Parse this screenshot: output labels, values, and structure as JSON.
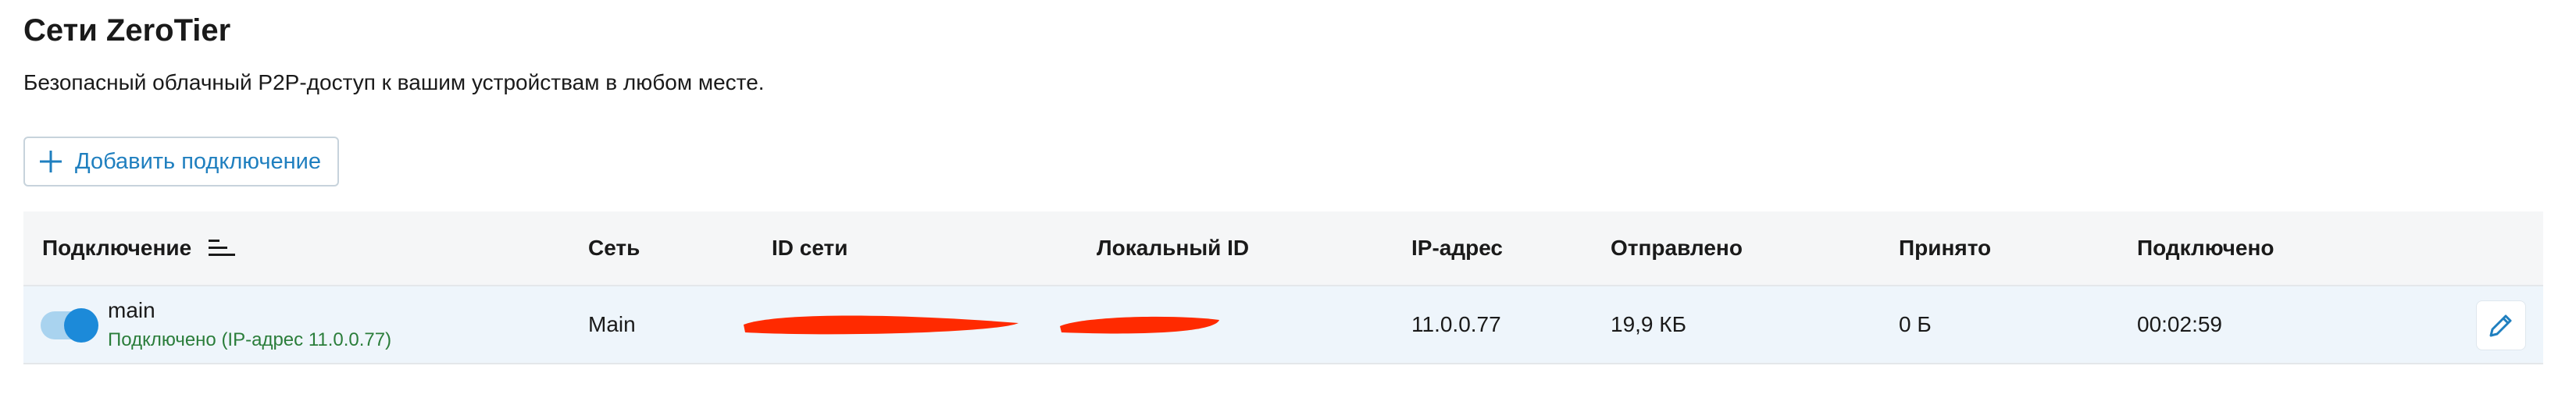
{
  "page": {
    "title": "Сети ZeroTier",
    "subtitle": "Безопасный облачный P2P-доступ к вашим устройствам в любом месте."
  },
  "actions": {
    "add_label": "Добавить подключение"
  },
  "table": {
    "headers": {
      "connection": "Подключение",
      "network": "Сеть",
      "network_id": "ID сети",
      "local_id": "Локальный ID",
      "ip": "IP-адрес",
      "sent": "Отправлено",
      "received": "Принято",
      "connected": "Подключено"
    },
    "rows": [
      {
        "name": "main",
        "enabled": true,
        "status": "Подключено (IP-адрес 11.0.0.77)",
        "network": "Main",
        "network_id": "",
        "local_id": "",
        "ip": "11.0.0.77",
        "sent": "19,9 КБ",
        "received": "0 Б",
        "connected": "00:02:59"
      }
    ]
  },
  "colors": {
    "accent": "#1f7fbf",
    "status_ok": "#2a7d3a",
    "redaction": "#ff2a00",
    "row_bg": "#eef5fb",
    "header_bg": "#f5f6f7"
  },
  "icons": {
    "add": "plus-icon",
    "sort": "sort-icon",
    "edit": "pencil-icon"
  }
}
